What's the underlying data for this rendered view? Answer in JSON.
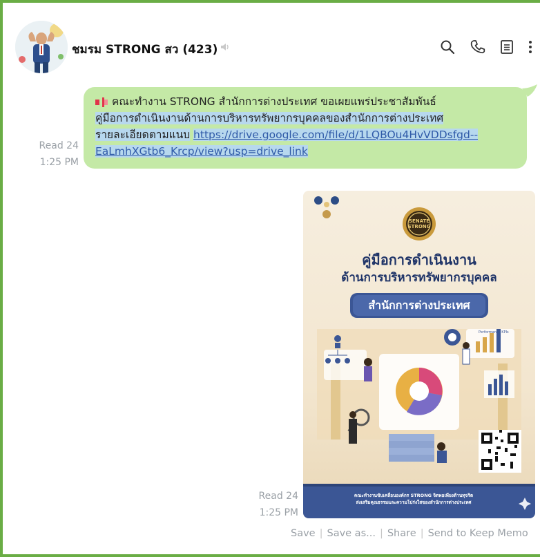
{
  "chat": {
    "title": "ชมรม STRONG สว (423)",
    "icons": [
      "mute-icon",
      "search-icon",
      "phone-icon",
      "notes-icon",
      "more-icon"
    ]
  },
  "messages": [
    {
      "type": "text",
      "lines": [
        "คณะทำงาน STRONG สำนักการต่างประเทศ ขอเผยแพร่ประชาสัมพันธ์",
        "คู่มือการดำเนินงานด้านการบริหารทรัพยากรบุคคลของสำนักการต่างประเทศ",
        "รายละเอียดตามแนบ"
      ],
      "link_line1": "https://drive.google.com/file/d/1LQBOu4HvVDDsfgd--",
      "link_line2": "EaLmhXGtb6_Krcp/view?usp=drive_link",
      "read": "Read 24",
      "time": "1:25 PM"
    },
    {
      "type": "image",
      "poster": {
        "seal_line1": "SENATE",
        "seal_line2": "STRONG",
        "title_line1": "คู่มือการดำเนินงาน",
        "title_line2": "ด้านการบริหารทรัพยากรบุคคล",
        "subtitle": "สำนักการต่างประเทศ",
        "badge_small": "Performance KPIs",
        "footer_line1": "คณะทำงานขับเคลื่อนองค์กร STRONG จิตพอเพียงต้านทุจริต",
        "footer_line2": "ส่งเสริมคุณธรรมและความโปร่งใสของสำนักการต่างประเทศ"
      },
      "read": "Read 24",
      "time": "1:25 PM",
      "actions": [
        "Save",
        "Save as...",
        "Share",
        "Send to Keep Memo"
      ]
    }
  ],
  "colors": {
    "frame": "#6aad45",
    "bubble": "#c4e9a6",
    "highlight": "#b7d8ee",
    "link": "#2f5aa8",
    "poster_navy": "#1f3468"
  }
}
